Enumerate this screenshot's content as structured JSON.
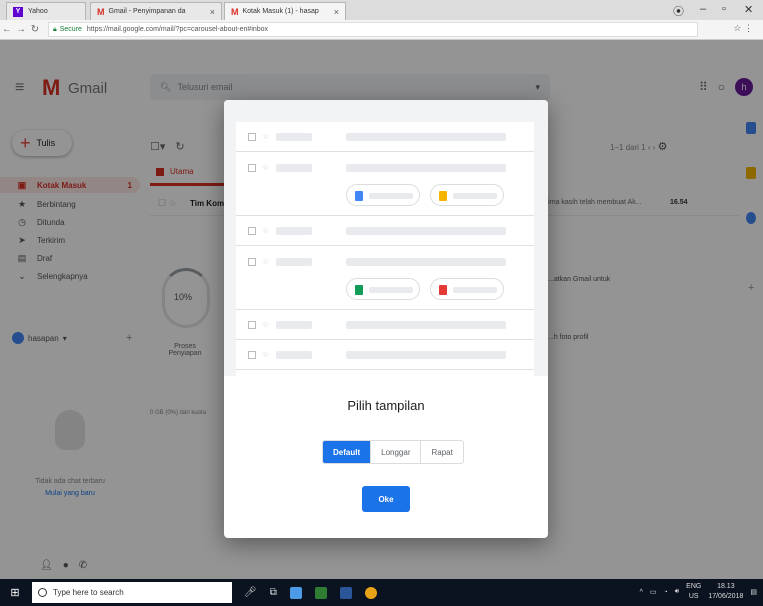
{
  "browser": {
    "tabs": [
      {
        "title": "Yahoo",
        "favicon": "Y"
      },
      {
        "title": "Gmail - Penyimpanan da",
        "favicon": "M"
      },
      {
        "title": "Kotak Masuk (1) - hasap",
        "favicon": "M"
      }
    ],
    "tab_close": "×",
    "url_secure": "Secure",
    "url": "https://mail.google.com/mail/?pc=carousel-about-en#inbox"
  },
  "gmail": {
    "logo_text": "Gmail",
    "search_placeholder": "Telusuri email",
    "avatar_letter": "h",
    "compose_label": "Tulis",
    "sidebar": [
      {
        "icon": "inbox-icon",
        "glyph": "▣",
        "label": "Kotak Masuk",
        "count": "1"
      },
      {
        "icon": "star-icon",
        "glyph": "★",
        "label": "Berbintang",
        "count": ""
      },
      {
        "icon": "clock-icon",
        "glyph": "◷",
        "label": "Ditunda",
        "count": ""
      },
      {
        "icon": "send-icon",
        "glyph": "➤",
        "label": "Terkirim",
        "count": ""
      },
      {
        "icon": "draft-icon",
        "glyph": "▤",
        "label": "Draf",
        "count": ""
      },
      {
        "icon": "chevron-down-icon",
        "glyph": "⌄",
        "label": "Selengkapnya",
        "count": ""
      }
    ],
    "hangout_user": "hasapan",
    "hangout_empty_text": "Tidak ada chat terbaru",
    "hangout_link": "Mulai yang baru",
    "pager": "1–1 dari 1",
    "primary_tab": "Utama",
    "mail_sender": "Tim Kom",
    "mail_snippet": "terima kasih telah membuat Ak...",
    "mail_time": "16.54",
    "promo_percent": "10%",
    "promo_label": "Proses Penyiapan",
    "storage_text": "0 GB (0%) dari kuota",
    "promo_right_1": "...atkan Gmail untuk",
    "promo_right_2": "...h foto profil"
  },
  "dialog": {
    "title": "Pilih tampilan",
    "options": [
      "Default",
      "Longgar",
      "Rapat"
    ],
    "selected_option": "Default",
    "ok_label": "Oke"
  },
  "taskbar": {
    "search_placeholder": "Type here to search",
    "lang": "ENG",
    "region": "US",
    "time": "18.13",
    "date": "17/06/2018"
  },
  "colors": {
    "accent_blue": "#1a73e8",
    "gmail_red": "#d93025",
    "doc_blue": "#4285f4",
    "slides_yellow": "#f4b400",
    "sheets_green": "#0f9d58",
    "pdf_red": "#e53935"
  }
}
